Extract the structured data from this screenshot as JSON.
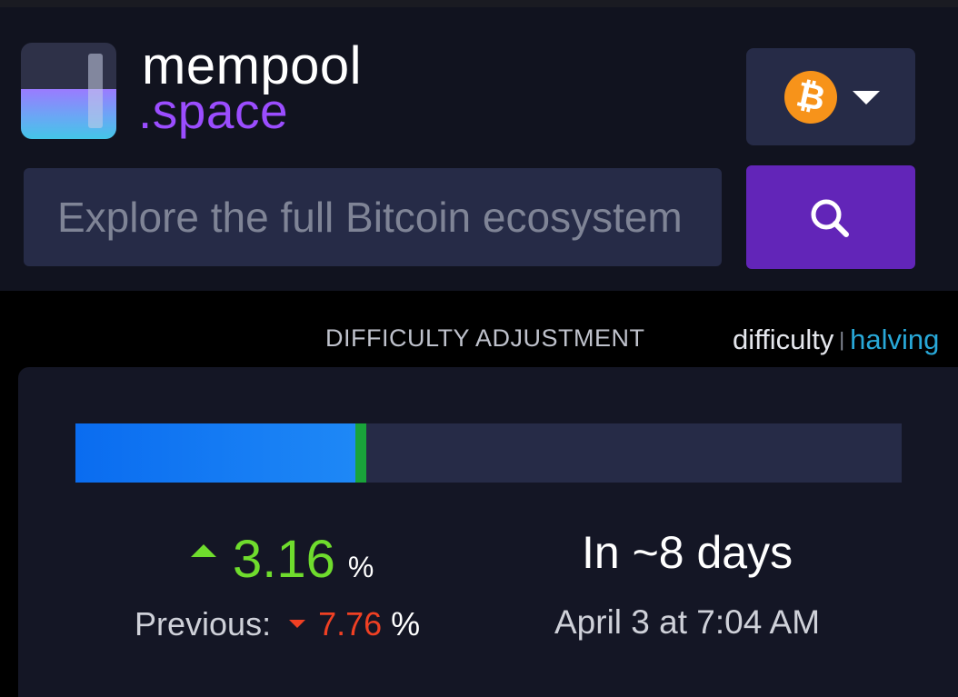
{
  "header": {
    "brand_primary": "mempool",
    "brand_secondary": ".space",
    "network": {
      "symbol": "₿",
      "icon": "bitcoin-icon",
      "caret_icon": "chevron-down-icon",
      "color": "#f7931a"
    },
    "search": {
      "placeholder": "Explore the full Bitcoin ecosystem",
      "value": "",
      "button_icon": "search-icon",
      "button_color": "#6225b8"
    }
  },
  "difficulty": {
    "section_title": "DIFFICULTY ADJUSTMENT",
    "switch": {
      "option_difficulty": "difficulty",
      "separator": "|",
      "option_halving": "halving",
      "active": "halving"
    },
    "progress": {
      "fraction": 0.34,
      "marker_fraction": 0.345,
      "fill_color": "#1e88f6",
      "marker_color": "#19a33a"
    },
    "change": {
      "direction": "up",
      "value": "3.16",
      "unit": "%",
      "color": "#6fdc2d"
    },
    "previous": {
      "label": "Previous:",
      "direction": "down",
      "value": "7.76",
      "unit": "%",
      "color": "#f04023"
    },
    "eta": {
      "relative": "In ~8 days",
      "date": "April 3 at 7:04 AM"
    }
  }
}
